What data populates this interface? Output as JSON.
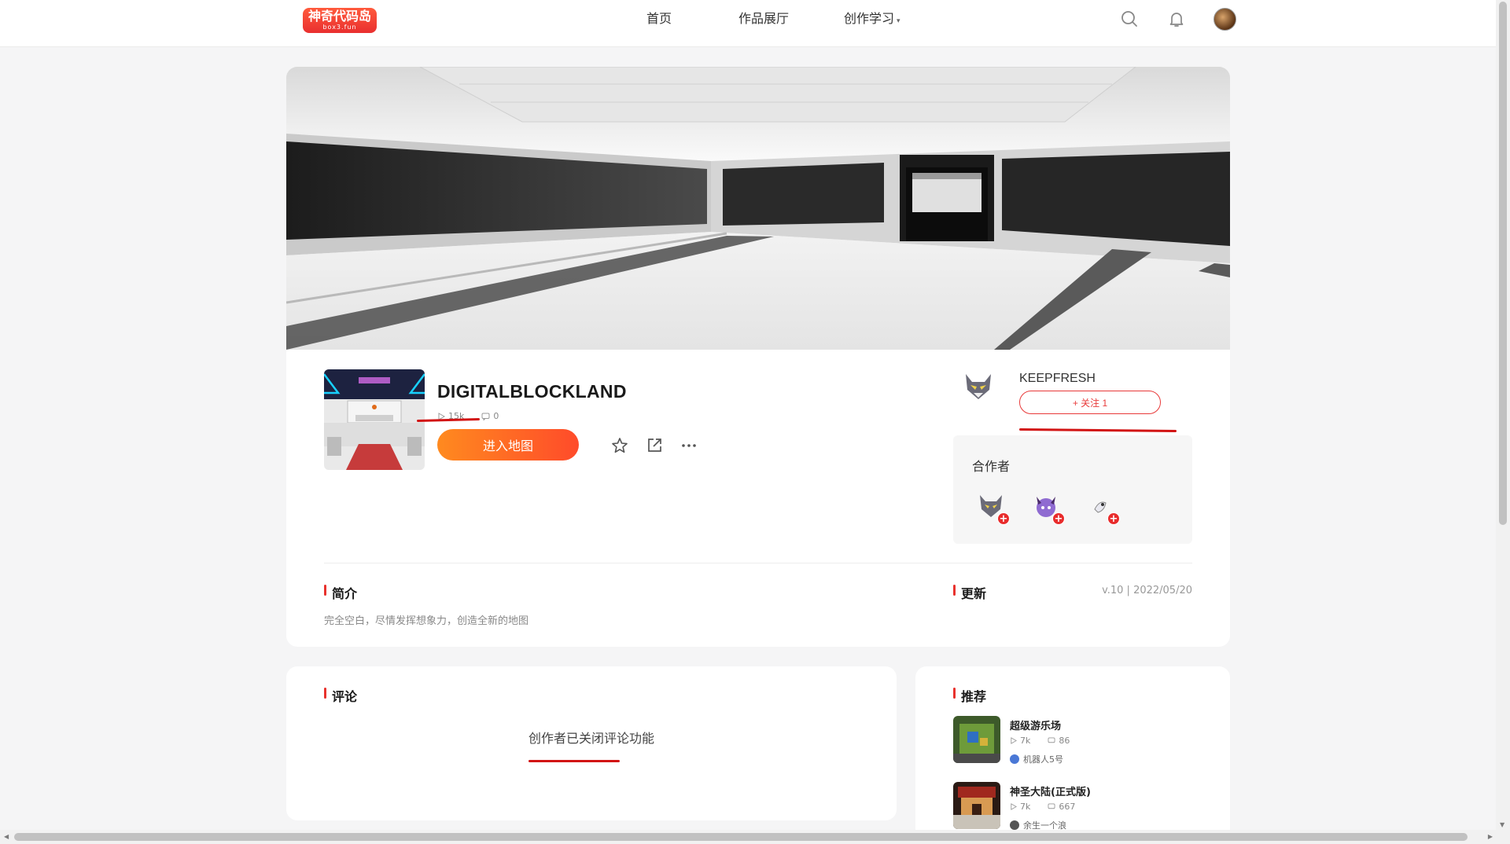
{
  "header": {
    "logo_text": "神奇代码岛",
    "logo_sub": "box3.fun",
    "nav": [
      {
        "label": "首页"
      },
      {
        "label": "作品展厅"
      },
      {
        "label": "创作学习"
      }
    ],
    "icons": [
      "search-icon",
      "bell-icon",
      "user-avatar"
    ]
  },
  "project": {
    "title": "DIGITALBLOCKLAND",
    "plays": "15k",
    "comments": "0",
    "enter_label": "进入地图",
    "actions": [
      "star-icon",
      "share-icon",
      "more-icon"
    ]
  },
  "author": {
    "name": "KEEPFRESH",
    "follow_label": "+ 关注 1"
  },
  "collaborators": {
    "label": "合作者",
    "count": 3
  },
  "intro": {
    "title": "简介",
    "text": "完全空白，尽情发挥想象力，创造全新的地图"
  },
  "update": {
    "title": "更新",
    "meta": "v.10 | 2022/05/20"
  },
  "comments_section": {
    "title": "评论",
    "empty_text": "创作者已关闭评论功能"
  },
  "recommend": {
    "title": "推荐",
    "items": [
      {
        "name": "超级游乐场",
        "plays": "7k",
        "comments": "86",
        "author": "机器人5号"
      },
      {
        "name": "神圣大陆(正式版)",
        "plays": "7k",
        "comments": "667",
        "author": "余生一个浪"
      }
    ]
  },
  "colors": {
    "accent": "#e8322d",
    "button_gradient_start": "#ff8a1f",
    "button_gradient_end": "#ff4b2a",
    "annotation_red": "#d21414"
  }
}
